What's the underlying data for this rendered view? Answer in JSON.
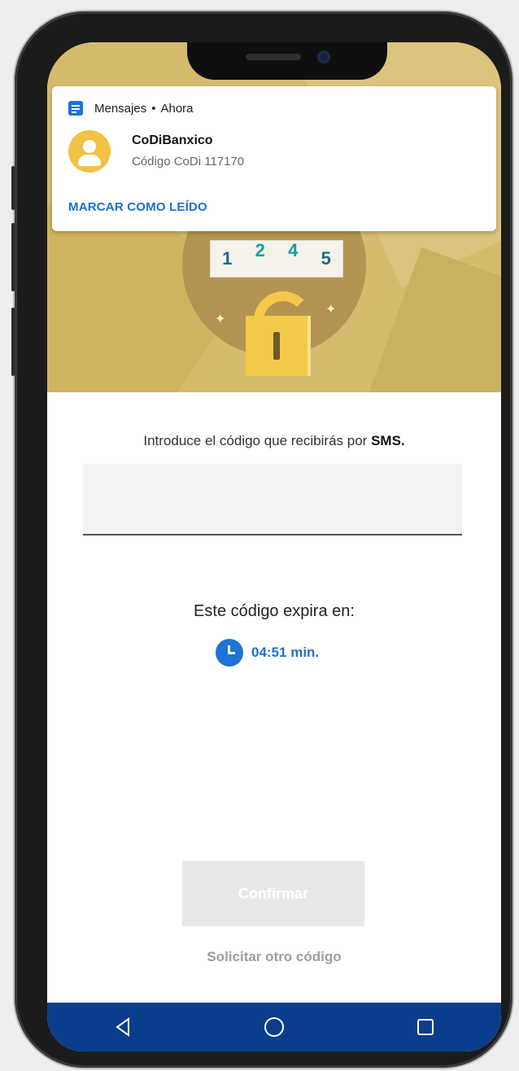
{
  "notification": {
    "app_name": "Mensajes",
    "separator": "•",
    "time": "Ahora",
    "sender": "CoDiBanxico",
    "message": "Código CoDi 117170",
    "action": "MARCAR COMO LEÍDO"
  },
  "hero": {
    "digits": [
      "1",
      "2",
      "4",
      "5"
    ]
  },
  "form": {
    "instruction_prefix": "Introduce el código que recibirás por ",
    "instruction_bold": "SMS.",
    "code_value": "",
    "expire_label": "Este código expira en:",
    "timer": "04:51 min."
  },
  "actions": {
    "confirm_label": "Confirmar",
    "resend_label": "Solicitar otro código"
  },
  "colors": {
    "accent_blue": "#1e73d6",
    "hero_gold": "#d6bb6c",
    "lock_yellow": "#f4c84a",
    "nav_bar": "#0a3d8c"
  },
  "icons": [
    "messages-app-icon",
    "avatar-icon",
    "unlocked-padlock-icon",
    "clock-icon",
    "back-icon",
    "home-icon",
    "recents-icon"
  ]
}
